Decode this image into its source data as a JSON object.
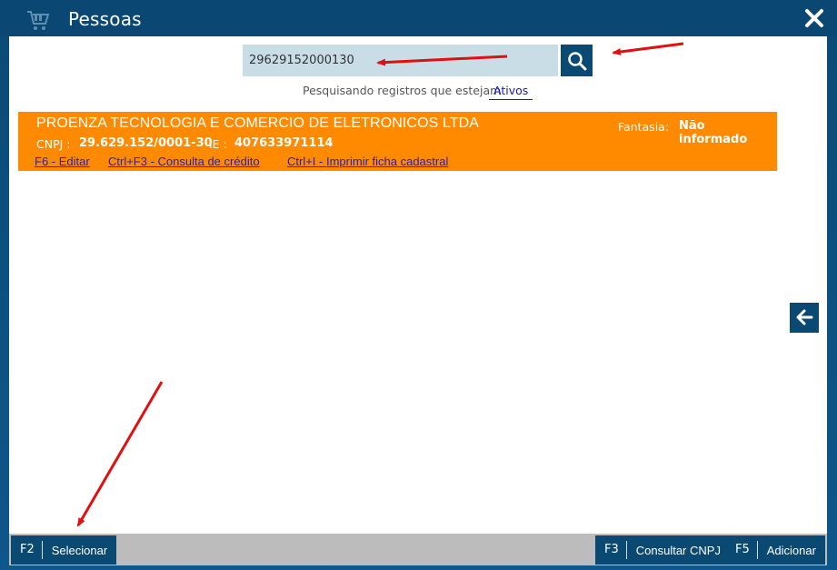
{
  "window": {
    "title": "Pessoas",
    "app_icon": "shopping-cart-icon",
    "close_icon": "close-icon"
  },
  "search": {
    "value": "29629152000130",
    "button_icon": "search-icon"
  },
  "filter": {
    "label": "Pesquisando registros que estejam",
    "value": "Ativos"
  },
  "record": {
    "company_name": "PROENZA TECNOLOGIA E COMERCIO DE ELETRONICOS LTDA",
    "fantasia_label": "Fantasia:",
    "fantasia_value": "Não informado",
    "cnpj_label": "CNPJ :",
    "cnpj_value": "29.629.152/0001-30",
    "ie_label": "IE :",
    "ie_value": "407633971114",
    "links": [
      "F6 - Editar",
      "Ctrl+F3 - Consulta de crédito",
      "Ctrl+I - Imprimir ficha cadastral"
    ],
    "background_color": "#ff8a00"
  },
  "side": {
    "back_icon": "arrow-left-icon"
  },
  "footer": {
    "select": {
      "key": "F2",
      "label": "Selecionar"
    },
    "consult_cnpj": {
      "key": "F3",
      "label": "Consultar CNPJ"
    },
    "add": {
      "key": "F5",
      "label": "Adicionar"
    }
  },
  "annotations": {
    "arrow_color": "#e01010"
  },
  "colors": {
    "primary": "#0a4a72",
    "accent": "#ff8a00",
    "link": "#2020d0"
  }
}
